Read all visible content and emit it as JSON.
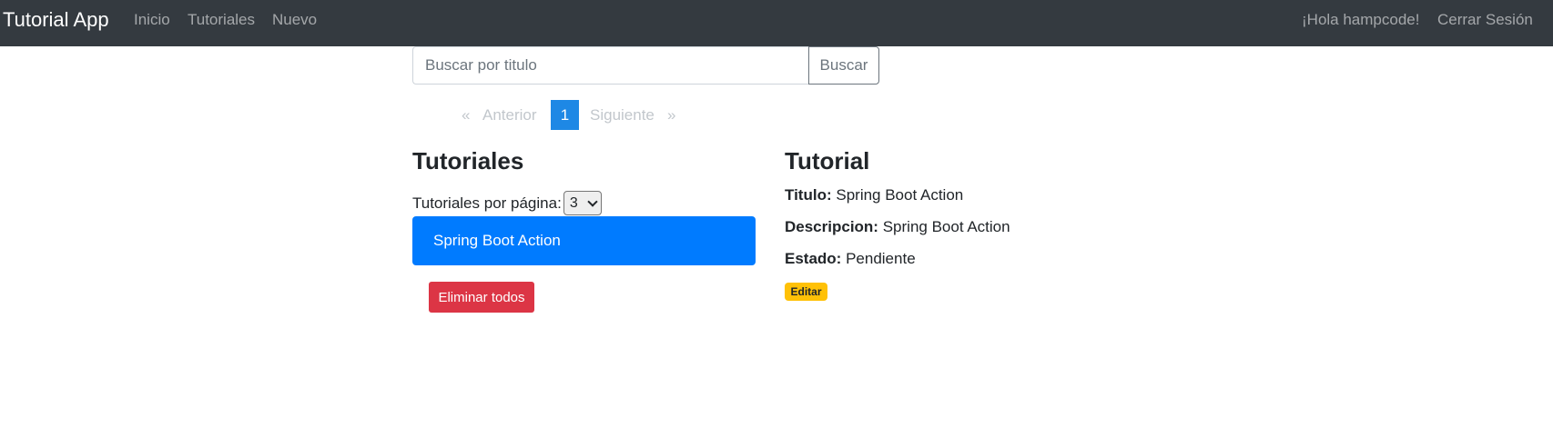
{
  "navbar": {
    "brand": "Tutorial App",
    "links": [
      "Inicio",
      "Tutoriales",
      "Nuevo"
    ],
    "greeting": "¡Hola hampcode!",
    "logout": "Cerrar Sesión"
  },
  "search": {
    "placeholder": "Buscar por titulo",
    "value": "",
    "button_label": "Buscar"
  },
  "pagination": {
    "first": "«",
    "previous": "Anterior",
    "current": "1",
    "next": "Siguiente",
    "last": "»"
  },
  "list": {
    "heading": "Tutoriales",
    "per_page_label": "Tutoriales por página:",
    "per_page_value": "3",
    "items": [
      "Spring Boot Action"
    ],
    "delete_all_label": "Eliminar todos"
  },
  "detail": {
    "heading": "Tutorial",
    "title_label": "Titulo:",
    "title_value": "Spring Boot Action",
    "description_label": "Descripcion:",
    "description_value": "Spring Boot Action",
    "status_label": "Estado:",
    "status_value": "Pendiente",
    "edit_label": "Editar"
  },
  "colors": {
    "navbar_bg": "#343a40",
    "primary": "#007bff",
    "page_active": "#1e88e5",
    "danger": "#dc3545",
    "warning": "#ffc107"
  }
}
